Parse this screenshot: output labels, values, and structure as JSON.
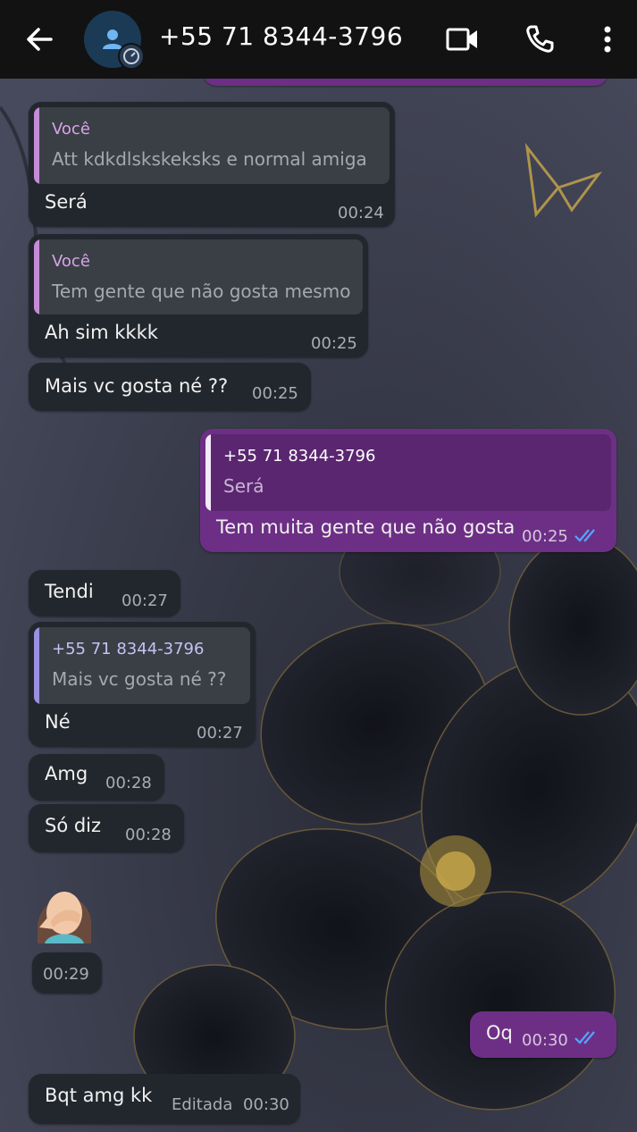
{
  "header": {
    "contact": "+55 71 8344-3796"
  },
  "messages": [
    {
      "quote_name": "Você",
      "quote_text": "Att kdkdlskskeksks e normal amiga",
      "text": "Será",
      "time": "00:24"
    },
    {
      "quote_name": "Você",
      "quote_text": "Tem gente que não gosta mesmo",
      "text": "Ah sim kkkk",
      "time": "00:25"
    },
    {
      "text": "Mais vc gosta né ??",
      "time": "00:25"
    },
    {
      "quote_name": "+55 71 8344-3796",
      "quote_text": "Será",
      "text": "Tem muita gente que não gosta",
      "time": "00:25"
    },
    {
      "text": "Tendi",
      "time": "00:27"
    },
    {
      "quote_name": "+55 71 8344-3796",
      "quote_text": "Mais vc gosta né ??",
      "text": "Né",
      "time": "00:27"
    },
    {
      "text": "Amg",
      "time": "00:28"
    },
    {
      "text": "Só diz",
      "time": "00:28"
    },
    {
      "emoji": "🤦‍♀️",
      "time": "00:29"
    },
    {
      "text": "Oq",
      "time": "00:30"
    },
    {
      "text": "Bqt amg kk",
      "edited_label": "Editada",
      "time": "00:30"
    }
  ],
  "colors": {
    "incoming_bubble": "#22272d",
    "outgoing_bubble": "#6d2f85",
    "quote_bar_self": "#c48bd8",
    "quote_bar_other": "#9a8fe0",
    "read_ticks": "#53a6ff"
  }
}
